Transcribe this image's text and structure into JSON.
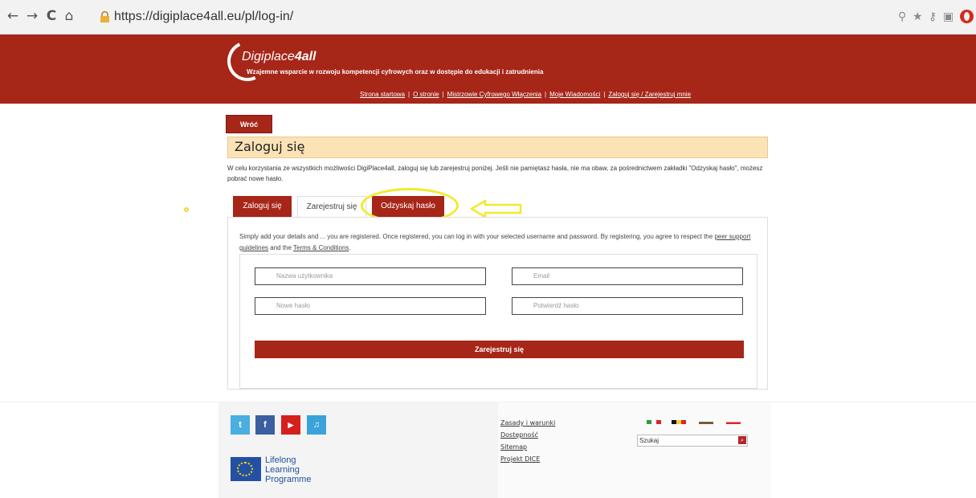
{
  "browser": {
    "url": "https://digiplace4all.eu/pl/log-in/",
    "back_icon": "←",
    "forward_icon": "→",
    "reload_icon": "C",
    "home_icon": "⌂"
  },
  "header": {
    "site_name_prefix": "Digiplace",
    "site_name_suffix": "4all",
    "tagline": "Wzajemne wsparcie w rozwoju kompetencji cyfrowych oraz w dostępie do edukacji i zatrudnienia",
    "nav": [
      "Strona startowa",
      "O stronie",
      "Mistrzowie Cyfrowego Włączenia",
      "Moje Wiadomości",
      "Zaloguj się / Zarejestruj mnie"
    ],
    "nav_separator": "|"
  },
  "main": {
    "back_label": "Wróć",
    "title": "Zaloguj się",
    "intro": "W celu korzystania ze wszystkich możliwości DigiPlace4all, zaloguj się lub zarejestruj poniżej. Jeśli nie pamiętasz hasła, nie ma obaw, za pośrednictwem zakładki \"Odzyskaj hasło\", możesz pobrać nowe hasło.",
    "tabs": [
      "Zaloguj się",
      "Zarejestruj się",
      "Odzyskaj hasło"
    ],
    "panel_text_1": "Simply add your details and ... you are registered. Once registered, you can log in with your selected username and password. By registering, you agree to respect the ",
    "panel_link_1": "peer support guidelines",
    "panel_text_2": " and the ",
    "panel_link_2": "Terms & Conditions",
    "panel_text_3": ".",
    "fields": {
      "username": "Nazwa użytkownika",
      "email": "Email",
      "new_password": "Nowe hasło",
      "confirm_password": "Potwierdź hasło"
    },
    "submit_label": "Zarejestruj się"
  },
  "footer": {
    "social": [
      {
        "name": "twitter",
        "glyph": "t",
        "color": "#4aaee0"
      },
      {
        "name": "facebook",
        "glyph": "f",
        "color": "#3b5fa0"
      },
      {
        "name": "youtube",
        "glyph": "▶",
        "color": "#d6201c"
      },
      {
        "name": "music",
        "glyph": "♫",
        "color": "#3aa3d9"
      }
    ],
    "llp_text": [
      "Lifelong",
      "Learning",
      "Programme"
    ],
    "links": [
      "Zasady i warunki",
      "Dostępność",
      "Sitemap",
      "Projekt DICE"
    ],
    "search_value": "Szukaj"
  },
  "colors": {
    "brand_red": "#a62618",
    "title_bg": "#fbe3b6",
    "highlight_yellow": "#f2ea2c"
  }
}
